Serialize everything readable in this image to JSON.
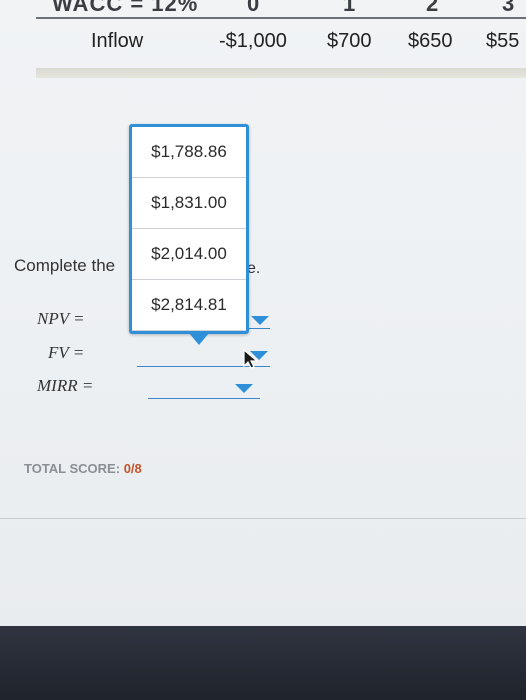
{
  "cashflow_table": {
    "header_cut": {
      "wacc_label": "WACC = 12%",
      "periods": [
        "0",
        "1",
        "2",
        "3"
      ]
    },
    "inflow_row": {
      "label": "Inflow",
      "values": [
        "-$1,000",
        "$700",
        "$650",
        "$55"
      ]
    }
  },
  "question": {
    "prompt_start": "Complete the",
    "prompt_end": "e.",
    "fields": [
      {
        "label": "NPV =",
        "value": ""
      },
      {
        "label": "FV =",
        "value": ""
      },
      {
        "label": "MIRR =",
        "value": ""
      }
    ]
  },
  "dropdown": {
    "options": [
      "$1,788.86",
      "$1,831.00",
      "$2,014.00",
      "$2,814.81"
    ]
  },
  "score": {
    "label": "TOTAL SCORE:",
    "value": "0/8"
  },
  "colors": {
    "accent": "#2f8fd8",
    "score_value": "#c2552e"
  }
}
